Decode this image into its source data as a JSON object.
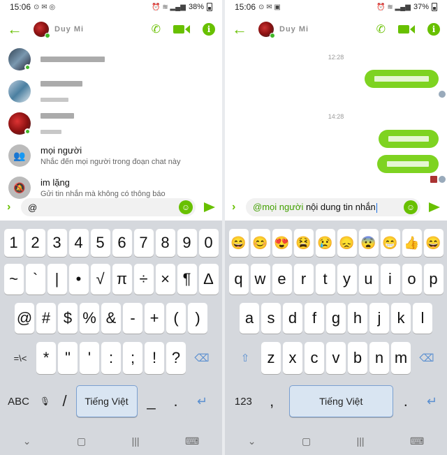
{
  "left": {
    "status": {
      "time": "15:06",
      "battery": "38%"
    },
    "header": {
      "contact_name": "Duy Mi"
    },
    "mentions": [
      {
        "kind": "contact"
      },
      {
        "kind": "contact"
      },
      {
        "kind": "contact"
      },
      {
        "kind": "everyone",
        "title": "mọi người",
        "subtitle": "Nhắc đến mọi người trong đoạn chat này"
      },
      {
        "kind": "silent",
        "title": "im lặng",
        "subtitle": "Gửi tin nhắn mà không có thông báo"
      }
    ],
    "input": {
      "value": "@"
    },
    "keyboard": {
      "row1": [
        "1",
        "2",
        "3",
        "4",
        "5",
        "6",
        "7",
        "8",
        "9",
        "0"
      ],
      "row2": [
        "~",
        "`",
        "|",
        "•",
        "√",
        "π",
        "÷",
        "×",
        "¶",
        "∆"
      ],
      "row3": [
        "@",
        "#",
        "$",
        "%",
        "&",
        "-",
        "+",
        "(",
        ")"
      ],
      "row4": [
        "=\\<",
        "*",
        "\"",
        "'",
        ":",
        ";",
        "!",
        "?"
      ],
      "row5": {
        "abc": "ABC",
        "slash": "/",
        "space": "Tiếng Việt",
        "underscore": "_",
        "dot": "."
      }
    }
  },
  "right": {
    "status": {
      "time": "15:06",
      "battery": "37%"
    },
    "header": {
      "contact_name": "Duy Mi"
    },
    "timestamps": [
      "12:28",
      "14:28"
    ],
    "input": {
      "mention": "@mọi người",
      "text": " nội dung tin nhắn"
    },
    "keyboard": {
      "emoji": [
        "😄",
        "😊",
        "😍",
        "😫",
        "😢",
        "😞",
        "😨",
        "😁",
        "👍",
        "😄"
      ],
      "row1": [
        "q",
        "w",
        "e",
        "r",
        "t",
        "y",
        "u",
        "i",
        "o",
        "p"
      ],
      "row2": [
        "a",
        "s",
        "d",
        "f",
        "g",
        "h",
        "j",
        "k",
        "l"
      ],
      "row3": [
        "z",
        "x",
        "c",
        "v",
        "b",
        "n",
        "m"
      ],
      "row4": {
        "num": "123",
        "comma": ",",
        "space": "Tiếng Việt",
        "dot": "."
      }
    }
  }
}
